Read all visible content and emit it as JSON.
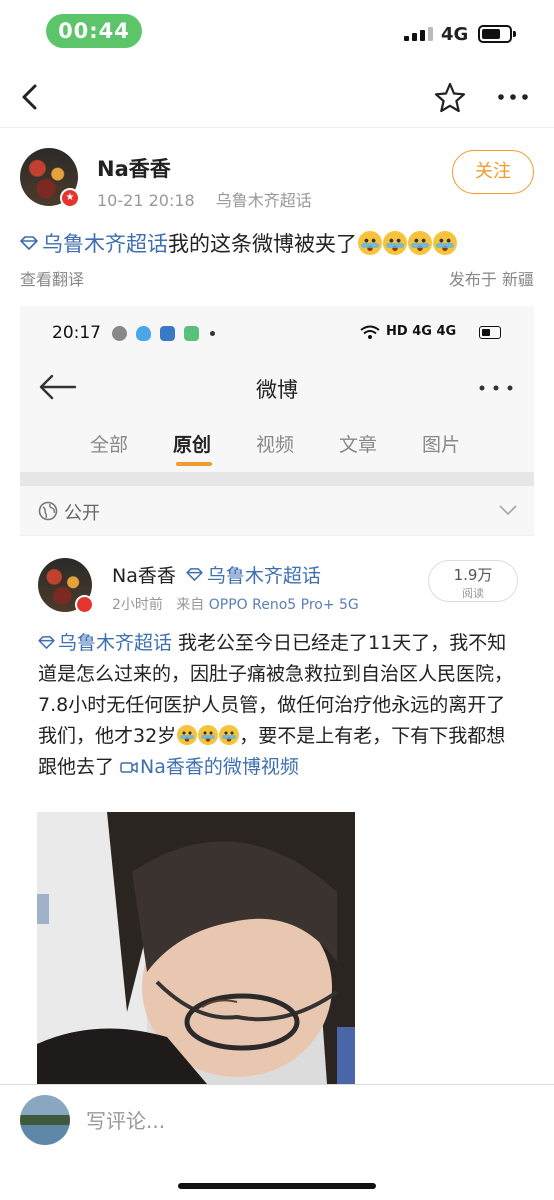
{
  "status_bar": {
    "time": "00:44",
    "network": "4G"
  },
  "nav": {},
  "post": {
    "author": "Na香香",
    "date": "10-21 20:18",
    "source": "乌鲁木齐超话",
    "follow_label": "关注",
    "topic": "乌鲁木齐超话",
    "text": "我的这条微博被夹了",
    "emoji_count": 4,
    "translate_label": "查看翻译",
    "location": "发布于 新疆"
  },
  "screenshot": {
    "status": {
      "time": "20:17",
      "network": "HD 4G 4G"
    },
    "nav_title": "微博",
    "tabs": [
      {
        "label": "全部"
      },
      {
        "label": "原创",
        "active": true
      },
      {
        "label": "视频"
      },
      {
        "label": "文章"
      },
      {
        "label": "图片"
      }
    ],
    "visibility": "公开",
    "post": {
      "author": "Na香香",
      "topic": "乌鲁木齐超话",
      "time": "2小时前",
      "source_prefix": "来自",
      "source_device": "OPPO Reno5 Pro+ 5G",
      "reads": "1.9万",
      "reads_label": "阅读",
      "topic_in_text": "乌鲁木齐超话",
      "text_part1": " 我老公至今日已经走了11天了，我不知道是怎么过来的，因肚子痛被急救拉到自治区人民医院，7.8小时无任何医护人员管，做任何治疗他永远的离开了我们，他才32岁",
      "text_part2": "，要不是上有老，下有下我都想跟他去了 ",
      "video_link": "Na香香的微博视频"
    }
  },
  "comment_bar": {
    "placeholder": "写评论..."
  },
  "colors": {
    "accent": "#f39a2c",
    "link": "#3e6fb0",
    "status_pill": "#5cc56a",
    "badge": "#e5332e"
  }
}
